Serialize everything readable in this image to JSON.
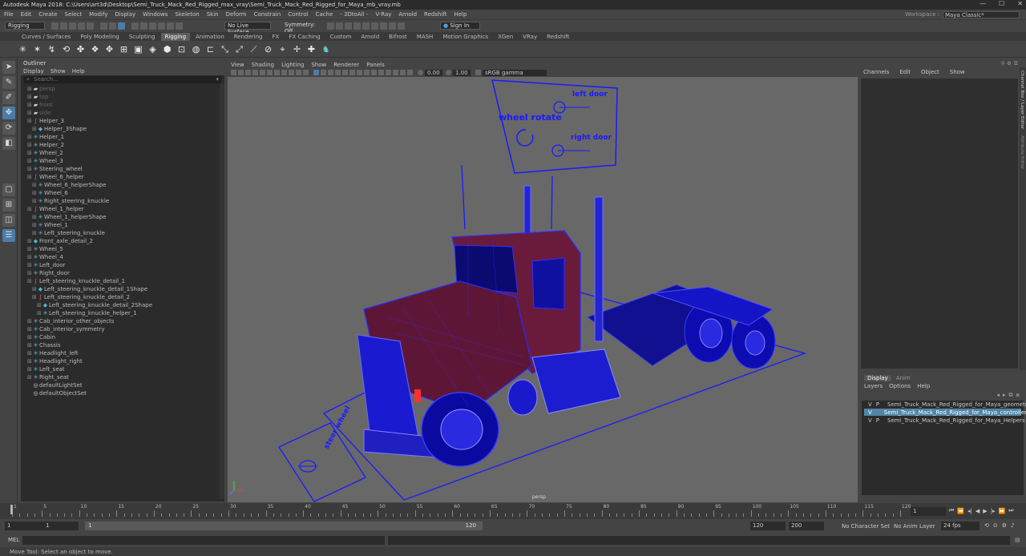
{
  "window": {
    "title": "Autodesk Maya 2018: C:\\Users\\art3d\\Desktop\\Semi_Truck_Mack_Red_Rigged_max_vray\\Semi_Truck_Mack_Red_Rigged_for_Maya_mb_vray.mb"
  },
  "menubar": [
    "File",
    "Edit",
    "Create",
    "Select",
    "Modify",
    "Display",
    "Windows",
    "Skeleton",
    "Skin",
    "Deform",
    "Constrain",
    "Control",
    "Cache",
    "- 3DtoAll -",
    "V-Ray",
    "Arnold",
    "Redshift",
    "Help"
  ],
  "workspace": {
    "label": "Workspace :",
    "value": "Maya Classic*"
  },
  "statusline": {
    "mode": "Rigging",
    "live_surface": "No Live Surface",
    "symmetry": "Symmetry: Off",
    "sign_in": "Sign In"
  },
  "shelf_tabs": [
    "Curves / Surfaces",
    "Poly Modeling",
    "Sculpting",
    "Rigging",
    "Animation",
    "Rendering",
    "FX",
    "FX Caching",
    "Custom",
    "Arnold",
    "Bifrost",
    "MASH",
    "Motion Graphics",
    "XGen",
    "VRay",
    "Redshift"
  ],
  "shelf_active": "Rigging",
  "outliner": {
    "title": "Outliner",
    "menu": [
      "Display",
      "Show",
      "Help"
    ],
    "search_placeholder": "Search...",
    "items": [
      {
        "label": "persp",
        "depth": 0,
        "icon": "camera-icon",
        "dim": true
      },
      {
        "label": "top",
        "depth": 0,
        "icon": "camera-icon",
        "dim": true
      },
      {
        "label": "front",
        "depth": 0,
        "icon": "camera-icon",
        "dim": true
      },
      {
        "label": "side",
        "depth": 0,
        "icon": "camera-icon",
        "dim": true
      },
      {
        "label": "Helper_3",
        "depth": 0,
        "icon": "curve-icon"
      },
      {
        "label": "Helper_3Shape",
        "depth": 1,
        "icon": "shape-icon"
      },
      {
        "label": "Helper_1",
        "depth": 0,
        "icon": "transform-icon"
      },
      {
        "label": "Helper_2",
        "depth": 0,
        "icon": "transform-icon"
      },
      {
        "label": "Wheel_2",
        "depth": 0,
        "icon": "transform-icon"
      },
      {
        "label": "Wheel_3",
        "depth": 0,
        "icon": "transform-icon"
      },
      {
        "label": "Steering_wheel",
        "depth": 0,
        "icon": "transform-icon"
      },
      {
        "label": "Wheel_6_helper",
        "depth": 0,
        "icon": "curve-icon"
      },
      {
        "label": "Wheel_6_helperShape",
        "depth": 1,
        "icon": "transform-icon"
      },
      {
        "label": "Wheel_6",
        "depth": 1,
        "icon": "transform-icon"
      },
      {
        "label": "Right_steering_knuckle",
        "depth": 1,
        "icon": "transform-icon"
      },
      {
        "label": "Wheel_1_helper",
        "depth": 0,
        "icon": "curve-icon"
      },
      {
        "label": "Wheel_1_helperShape",
        "depth": 1,
        "icon": "transform-icon"
      },
      {
        "label": "Wheel_1",
        "depth": 1,
        "icon": "transform-icon"
      },
      {
        "label": "Left_steering_knuckle",
        "depth": 1,
        "icon": "transform-icon"
      },
      {
        "label": "Front_axle_detail_2",
        "depth": 0,
        "icon": "shape-icon"
      },
      {
        "label": "Wheel_5",
        "depth": 0,
        "icon": "transform-icon"
      },
      {
        "label": "Wheel_4",
        "depth": 0,
        "icon": "transform-icon"
      },
      {
        "label": "Left_door",
        "depth": 0,
        "icon": "transform-icon"
      },
      {
        "label": "Right_door",
        "depth": 0,
        "icon": "transform-icon"
      },
      {
        "label": "Left_steering_knuckle_detail_1",
        "depth": 0,
        "icon": "curve-icon"
      },
      {
        "label": "Left_steering_knuckle_detail_1Shape",
        "depth": 1,
        "icon": "shape-icon"
      },
      {
        "label": "Left_steering_knuckle_detail_2",
        "depth": 1,
        "icon": "curve-icon"
      },
      {
        "label": "Left_steering_knuckle_detail_2Shape",
        "depth": 2,
        "icon": "shape-icon"
      },
      {
        "label": "Left_steering_knuckle_helper_1",
        "depth": 2,
        "icon": "transform-icon"
      },
      {
        "label": "Cab_interior_other_objects",
        "depth": 0,
        "icon": "transform-icon"
      },
      {
        "label": "Cab_interior_symmetry",
        "depth": 0,
        "icon": "transform-icon"
      },
      {
        "label": "Cabin",
        "depth": 0,
        "icon": "transform-icon"
      },
      {
        "label": "Chassis",
        "depth": 0,
        "icon": "transform-icon"
      },
      {
        "label": "Headlight_left",
        "depth": 0,
        "icon": "transform-icon"
      },
      {
        "label": "Headlight_right",
        "depth": 0,
        "icon": "transform-icon"
      },
      {
        "label": "Left_seat",
        "depth": 0,
        "icon": "transform-icon"
      },
      {
        "label": "Right_seat",
        "depth": 0,
        "icon": "transform-icon"
      },
      {
        "label": "defaultLightSet",
        "depth": 0,
        "icon": "set-icon",
        "noexp": true
      },
      {
        "label": "defaultObjectSet",
        "depth": 0,
        "icon": "set-icon",
        "noexp": true
      }
    ]
  },
  "viewport": {
    "menu": [
      "View",
      "Shading",
      "Lighting",
      "Show",
      "Renderer",
      "Panels"
    ],
    "exposure": "0.00",
    "gamma": "1.00",
    "colorspace": "sRGB gamma",
    "camera_label": "persp",
    "board": {
      "left_door": "left door",
      "right_door": "right door",
      "wheel_rotate": "wheel rotate"
    },
    "floor_sign": "steer wheel"
  },
  "channels": {
    "menu": [
      "Channels",
      "Edit",
      "Object",
      "Show"
    ],
    "side_tabs": [
      "Channel Box / Layer Editor",
      "Attribute Editor"
    ]
  },
  "layers": {
    "tabs": [
      "Display",
      "Anim"
    ],
    "menu": [
      "Layers",
      "Options",
      "Help"
    ],
    "rows": [
      {
        "v": "V",
        "p": "P",
        "name": "Semi_Truck_Mack_Red_Rigged_for_Maya_geometry",
        "color": "#1418c8",
        "selected": false
      },
      {
        "v": "V",
        "p": "",
        "name": "Semi_Truck_Mack_Red_Rigged_for_Maya_controllers",
        "color": "#101080",
        "selected": true
      },
      {
        "v": "V",
        "p": "P",
        "name": "Semi_Truck_Mack_Red_Rigged_for_Maya_Helpers",
        "color": "#a01030",
        "selected": false
      }
    ]
  },
  "timeline": {
    "ticks": [
      "1",
      "",
      "2",
      "",
      "",
      "",
      "",
      "",
      "",
      "",
      "",
      "",
      "",
      "",
      "",
      "",
      "",
      "",
      "",
      "",
      "",
      "",
      "",
      "",
      "",
      "",
      "",
      "",
      "",
      "",
      "",
      "",
      "",
      "",
      "",
      "",
      "",
      "",
      "",
      "",
      "",
      "",
      "",
      "",
      "",
      "",
      "",
      "",
      "",
      "",
      "",
      "",
      "",
      "",
      "",
      "",
      "",
      "",
      "",
      "",
      "",
      "",
      "",
      "",
      "",
      "",
      "",
      "",
      "",
      "",
      "",
      "",
      "",
      "",
      "",
      "",
      "",
      "",
      "",
      "",
      "",
      "",
      "",
      "",
      "",
      "",
      "",
      "",
      "",
      "",
      "",
      "",
      "",
      "",
      "",
      "",
      "",
      "",
      "",
      "",
      "",
      "",
      "",
      "",
      "",
      "",
      "",
      "",
      "",
      "",
      "",
      "",
      "",
      "",
      "",
      "",
      "",
      "",
      "",
      "",
      "",
      "",
      "",
      "",
      "",
      "",
      "",
      "",
      "",
      "",
      "",
      "",
      ""
    ],
    "labels": [
      "1",
      "5",
      "10",
      "15",
      "20",
      "25",
      "30",
      "35",
      "40",
      "45",
      "50",
      "55",
      "60",
      "65",
      "70",
      "75",
      "80",
      "85",
      "90",
      "95",
      "100",
      "105",
      "110",
      "115",
      "120"
    ],
    "current": "1"
  },
  "range": {
    "start": "1",
    "inner_start": "1",
    "slider_start": "1",
    "slider_end": "120",
    "end": "120",
    "outer_end": "200",
    "character_set": "No Character Set",
    "anim_layer": "No Anim Layer",
    "fps": "24 fps"
  },
  "cmdline": {
    "label": "MEL"
  },
  "helpline": {
    "text": "Move Tool: Select an object to move."
  },
  "colors": {
    "wire_blue": "#1a1aff",
    "body_red": "#6a1a3a",
    "viewport_bg": "#686868",
    "accent": "#4a7ca8"
  }
}
